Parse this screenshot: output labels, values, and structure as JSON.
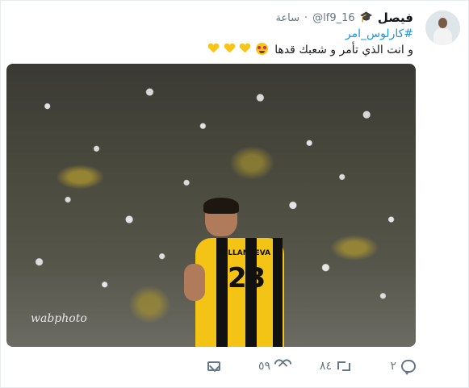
{
  "tweet": {
    "display_name": "فيصل",
    "name_emoji_icon": "graduation-cap-icon",
    "handle": "@lf9_16",
    "separator": "·",
    "time": "ساعة",
    "hashtag": "#كارلوس_امر",
    "text": "و انت الذي تأمر و شعبك قدها",
    "emojis": [
      "heart-eyes-face-icon",
      "yellow-heart-icon",
      "yellow-heart-icon",
      "yellow-heart-icon"
    ],
    "image": {
      "jersey_name": "VILLANUEVA",
      "jersey_number": "23",
      "watermark": "wabphoto"
    },
    "actions": {
      "reply_count": "٢",
      "retweet_count": "٨٤",
      "like_count": "٥٩"
    }
  },
  "colors": {
    "accent": "#1b95e0",
    "muted": "#657786",
    "text": "#14171a"
  }
}
